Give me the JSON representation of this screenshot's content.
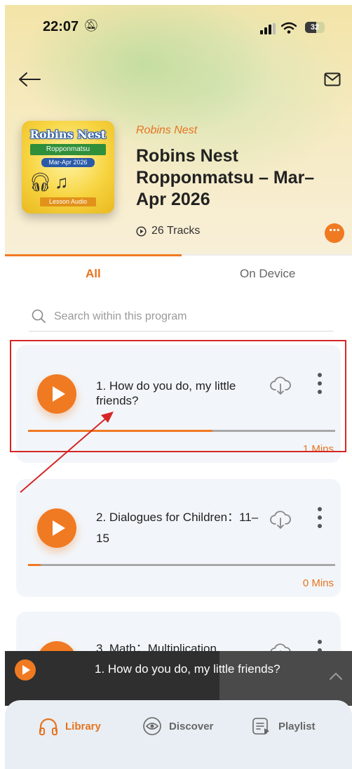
{
  "status_bar": {
    "time": "22:07",
    "battery": "32"
  },
  "header": {
    "back_icon": "arrow-left-icon",
    "mail_icon": "mail-icon"
  },
  "cover_art": {
    "title": "Robins Nest",
    "subtitle": "Ropponmatsu",
    "date": "Mar-Apr 2026",
    "label": "Lesson Audio"
  },
  "program": {
    "category": "Robins Nest",
    "title": "Robins Nest Ropponmatsu – Mar–Apr 2026",
    "tracks_label": "26 Tracks"
  },
  "tabs": [
    {
      "label": "All",
      "active": true
    },
    {
      "label": "On Device",
      "active": false
    }
  ],
  "search": {
    "placeholder": "Search within this program"
  },
  "tracks": [
    {
      "title": "1. How do you do, my little friends?",
      "duration": "1 Mins",
      "progress": 0.6
    },
    {
      "title": "2. Dialogues for Children：11–15",
      "duration": "0 Mins",
      "progress": 0.04
    },
    {
      "title": "3. Math：Multiplication"
    }
  ],
  "mini_player": {
    "title": "1. How do you do, my little friends?"
  },
  "nav": [
    {
      "label": "Library",
      "icon": "headphones-icon",
      "active": true
    },
    {
      "label": "Discover",
      "icon": "eye-icon",
      "active": false
    },
    {
      "label": "Playlist",
      "icon": "playlist-icon",
      "active": false
    }
  ],
  "colors": {
    "accent": "#f07a22",
    "annotation": "#d62626"
  }
}
